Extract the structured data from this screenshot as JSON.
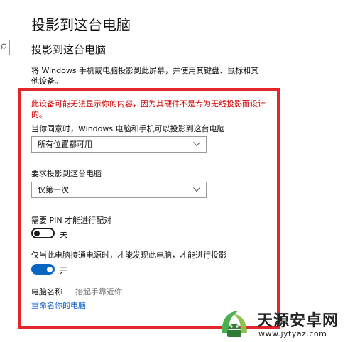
{
  "header": {
    "page_title": "投影到这台电脑"
  },
  "section": {
    "title": "投影到这台电脑",
    "description": "将 Windows 手机或电脑投影到此屏幕，并使用其键盘、鼠标和其他设备。"
  },
  "warning": "此设备可能无法显示你的内容，因为其硬件不是专为无线投影而设计的。",
  "availability": {
    "label": "当你同意时，Windows 电脑和手机可以投影到这台电脑",
    "selected": "所有位置都可用"
  },
  "request": {
    "label": "要求投影到这台电脑",
    "selected": "仅第一次"
  },
  "pin": {
    "label": "需要 PIN 才能进行配对",
    "state": "关"
  },
  "power": {
    "label": "仅当此电脑接通电源时，才能发现此电脑，才能进行投影",
    "state": "开"
  },
  "pc_name": {
    "label": "电脑名称",
    "value": "抬起手靠近你",
    "rename_link": "重命名你的电脑"
  },
  "watermark": {
    "title": "天源安卓网",
    "url": "www.jytyaz.com"
  },
  "colors": {
    "highlight_border": "#e3262c",
    "warning_text": "#d20000",
    "accent": "#0a66c2",
    "link": "#0a5cc5"
  }
}
